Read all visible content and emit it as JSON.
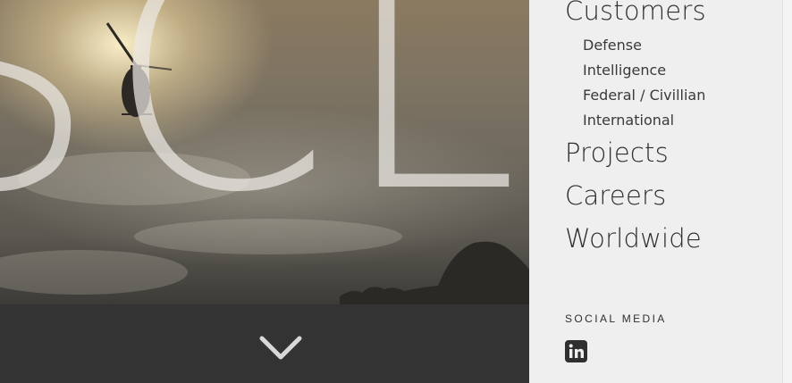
{
  "hero": {
    "background_letters": "SCL",
    "background_image": "helicopter-silhouette-against-cloudy-sky"
  },
  "scroll_down": {
    "icon": "chevron-down-icon"
  },
  "nav": {
    "customers": {
      "label": "Customers",
      "subitems": [
        {
          "label": "Defense"
        },
        {
          "label": "Intelligence"
        },
        {
          "label": "Federal / Civillian"
        },
        {
          "label": "International"
        }
      ]
    },
    "projects": {
      "label": "Projects"
    },
    "careers": {
      "label": "Careers"
    },
    "worldwide": {
      "label": "Worldwide"
    }
  },
  "social": {
    "heading": "SOCIAL MEDIA",
    "links": [
      {
        "icon": "linkedin-icon"
      }
    ]
  },
  "colors": {
    "sidebar_bg": "#efefef",
    "dark_bar": "#333333",
    "nav_text": "#2f2f2f",
    "chevron": "#d8d8d8"
  }
}
